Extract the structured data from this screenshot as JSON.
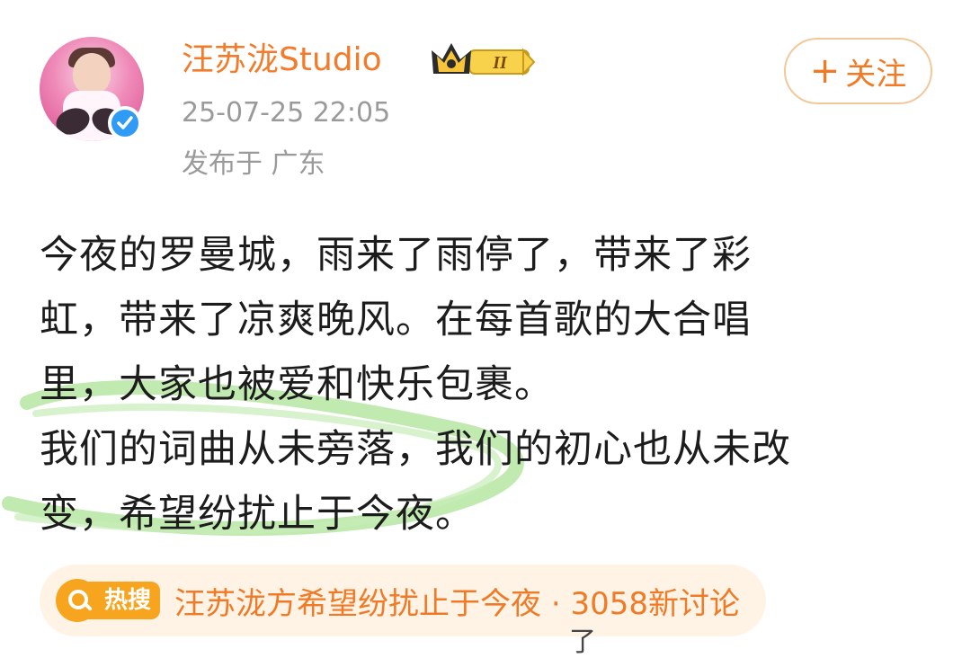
{
  "user": {
    "name": "汪苏泷Studio",
    "vip_level": "II",
    "verified": true
  },
  "post": {
    "time": "25-07-25 22:05",
    "location": "发布于 广东",
    "lines": [
      "今夜的罗曼城，雨来了雨停了，带来了彩",
      "虹，带来了凉爽晚风。在每首歌的大合唱",
      "里，大家也被爱和快乐包裹。",
      "我们的词曲从未旁落，我们的初心也从未改",
      "变，希望纷扰止于今夜。"
    ]
  },
  "follow_button": {
    "plus": "+",
    "label": "关注"
  },
  "hot_search": {
    "tag": "热搜",
    "text": "汪苏泷方希望纷扰止于今夜 · 3058新讨论"
  },
  "footer_fragment": "了",
  "colors": {
    "accent": "#f07a25",
    "highlight": "#b6e6a2",
    "hot_badge": "#f7a51f",
    "verified": "#2f9bf5"
  }
}
